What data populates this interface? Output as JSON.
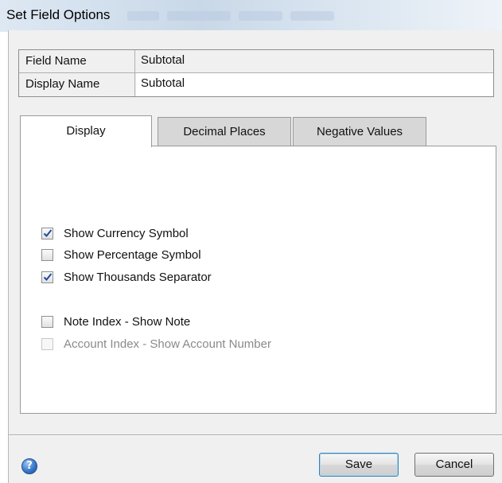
{
  "window": {
    "title": "Set Field Options"
  },
  "fields": {
    "field_name_label": "Field Name",
    "field_name_value": "Subtotal",
    "display_name_label": "Display Name",
    "display_name_value": "Subtotal"
  },
  "tabs": [
    {
      "label": "Display",
      "active": true
    },
    {
      "label": "Decimal Places",
      "active": false
    },
    {
      "label": "Negative Values",
      "active": false
    }
  ],
  "options": [
    {
      "label": "Show Currency Symbol",
      "checked": true,
      "enabled": true
    },
    {
      "label": "Show Percentage Symbol",
      "checked": false,
      "enabled": true
    },
    {
      "label": "Show Thousands Separator",
      "checked": true,
      "enabled": true
    },
    {
      "label": "Note Index - Show Note",
      "checked": false,
      "enabled": true
    },
    {
      "label": "Account Index - Show Account Number",
      "checked": false,
      "enabled": false
    }
  ],
  "footer": {
    "help_icon": "help-icon",
    "save_label": "Save",
    "cancel_label": "Cancel"
  }
}
